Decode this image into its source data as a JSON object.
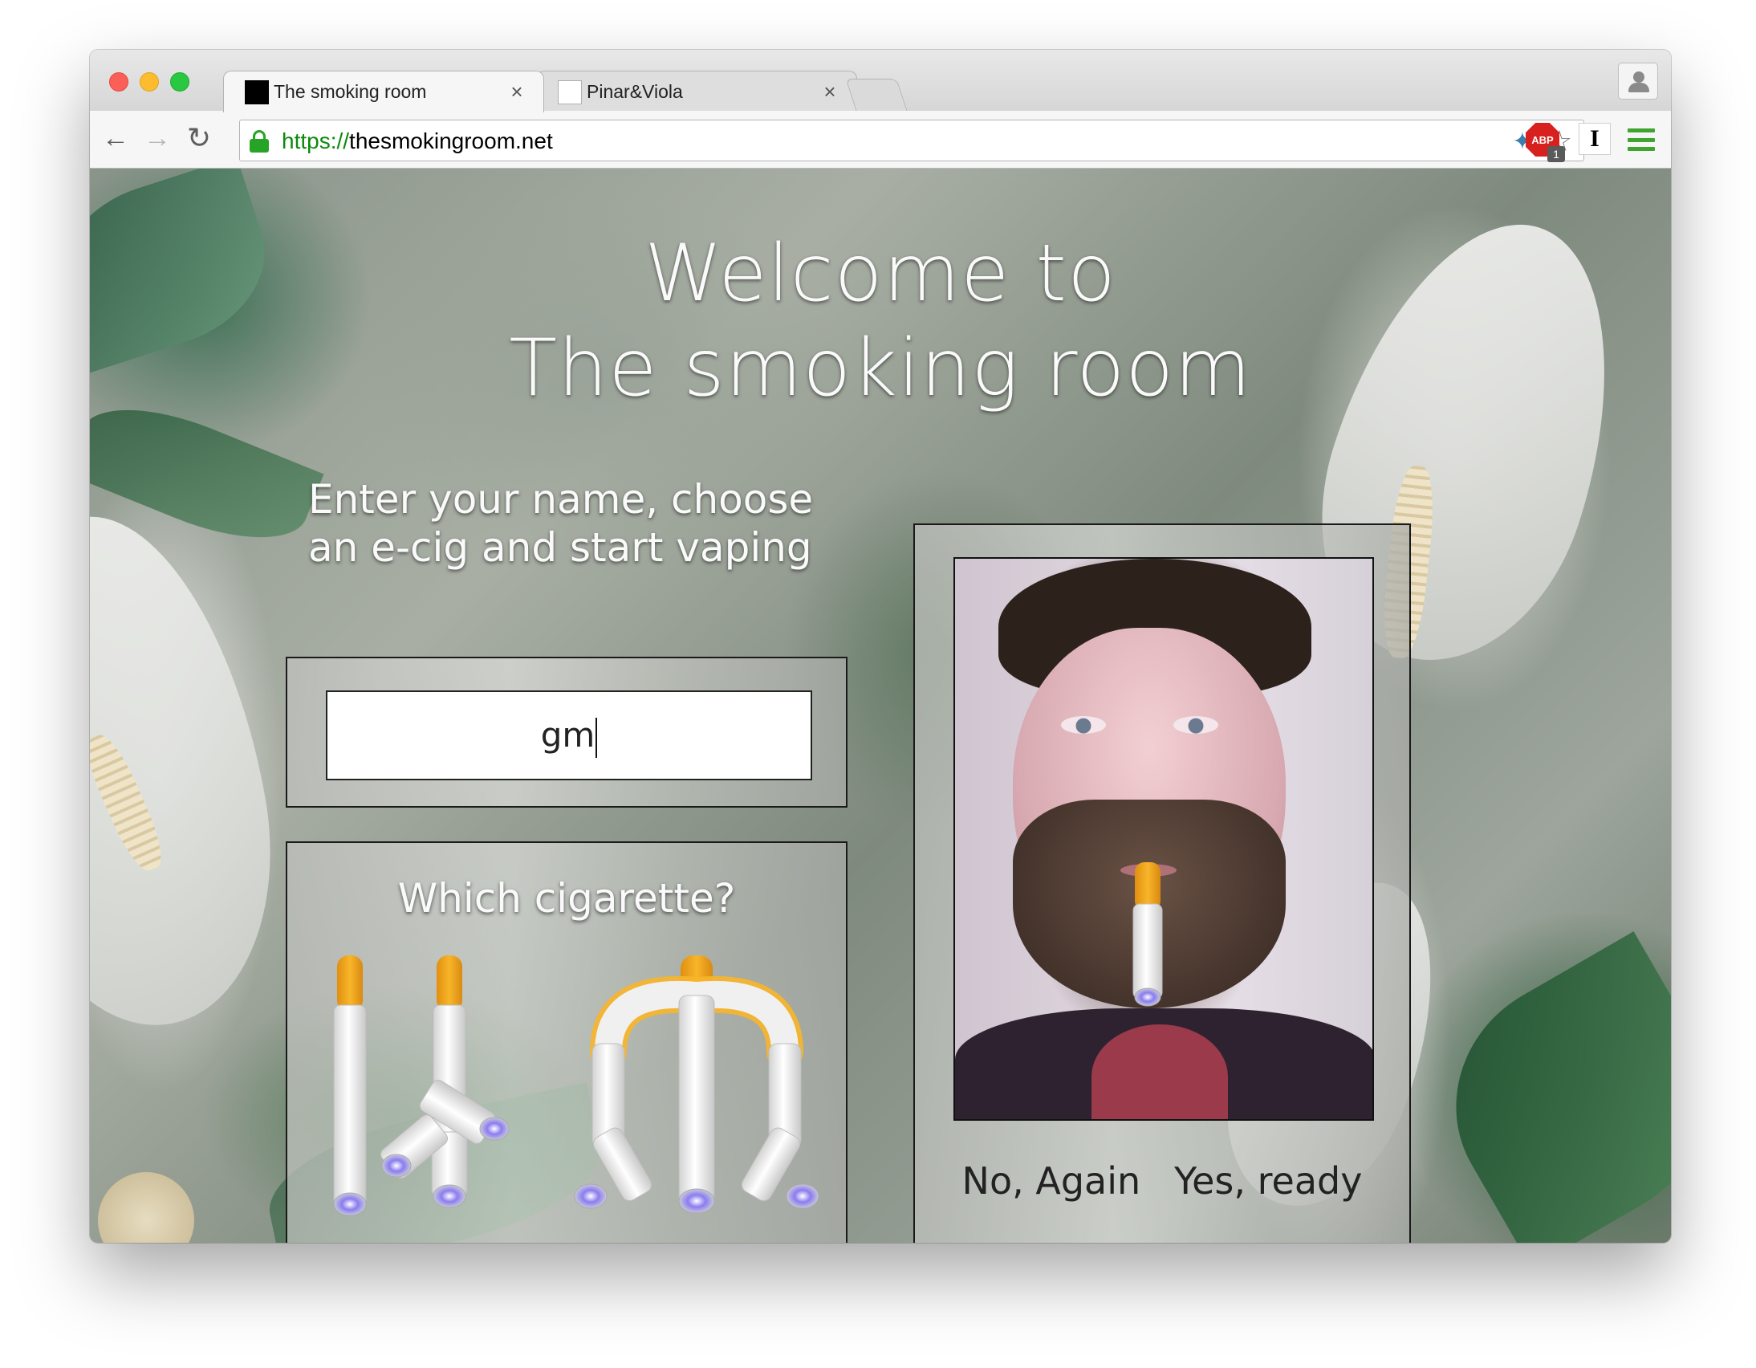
{
  "browser": {
    "tabs": [
      {
        "title": "The smoking room",
        "active": true
      },
      {
        "title": "Pinar&Viola",
        "active": false
      }
    ],
    "close_glyph": "×",
    "address": {
      "scheme": "https://",
      "host": "thesmokingroom.net"
    },
    "extensions": {
      "abp_label": "ABP",
      "abp_badge": "1",
      "instapaper_label": "I"
    }
  },
  "page": {
    "welcome_line1": "Welcome to",
    "welcome_line2": "The smoking room",
    "instructions": "Enter your name, choose an e-cig and start vaping",
    "name_input_value": "gm",
    "cigarette_prompt": "Which cigarette?",
    "cam_buttons": {
      "again": "No, Again",
      "ready": "Yes, ready"
    }
  },
  "colors": {
    "ecig_tip": "#f5a81a",
    "ecig_body": "#f4f4f4",
    "ecig_led": "#8a7cf0",
    "url_scheme": "#0c8a0c"
  }
}
